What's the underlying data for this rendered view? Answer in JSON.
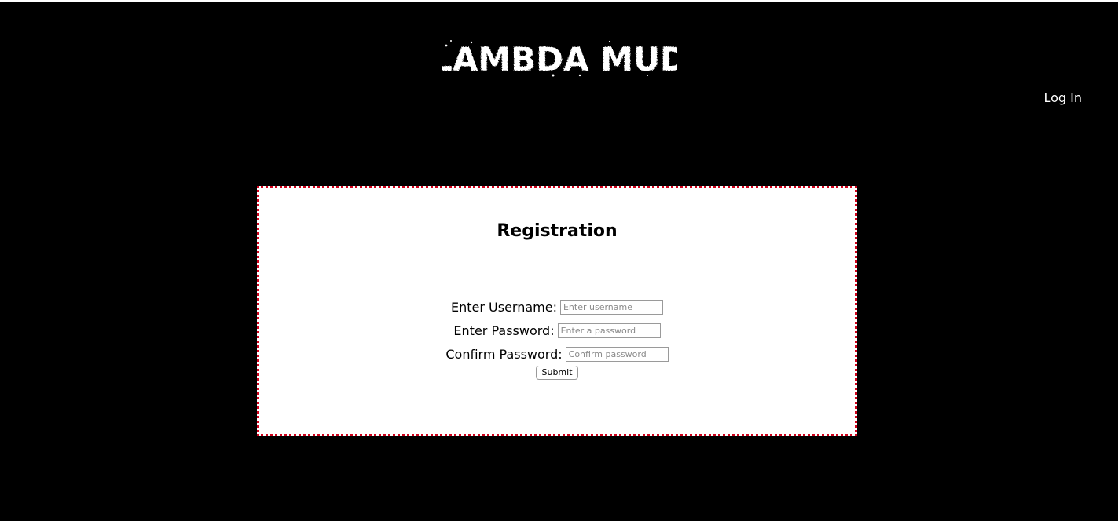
{
  "header": {
    "logo_text": "LAMBDA MUD",
    "login_label": "Log In"
  },
  "registration": {
    "title": "Registration",
    "username": {
      "label": "Enter Username:",
      "placeholder": "Enter username",
      "value": ""
    },
    "password": {
      "label": "Enter Password:",
      "placeholder": "Enter a password",
      "value": ""
    },
    "confirm": {
      "label": "Confirm Password:",
      "placeholder": "Confirm password",
      "value": ""
    },
    "submit_label": "Submit"
  },
  "colors": {
    "page_background": "#000000",
    "card_background": "#ffffff",
    "card_border": "#d0021b",
    "text_light": "#ffffff",
    "text_dark": "#000000"
  }
}
